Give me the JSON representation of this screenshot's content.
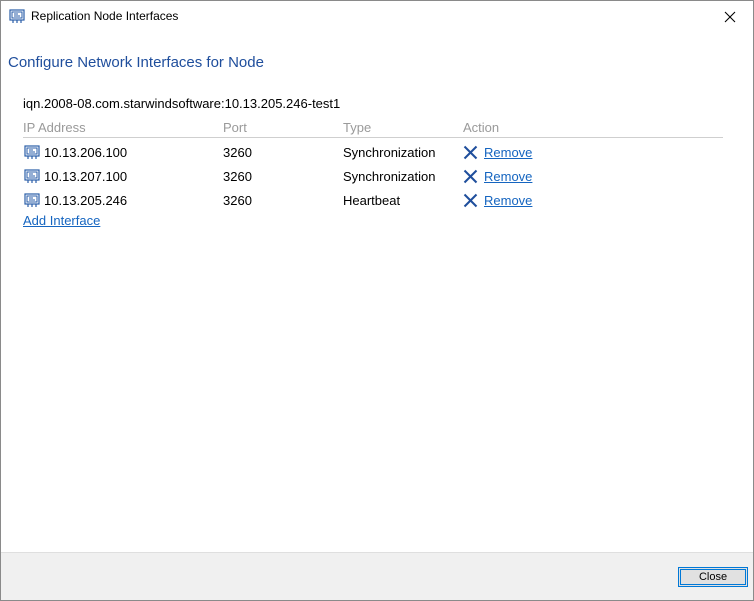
{
  "window": {
    "title": "Replication Node Interfaces",
    "icon": "network-adapter-icon"
  },
  "dialog": {
    "heading": "Configure Network Interfaces for Node",
    "node_name": "iqn.2008-08.com.starwindsoftware:10.13.205.246-test1"
  },
  "table": {
    "columns": [
      "IP Address",
      "Port",
      "Type",
      "Action"
    ],
    "rows": [
      {
        "ip": "10.13.206.100",
        "port": "3260",
        "type": "Synchronization",
        "action": "Remove"
      },
      {
        "ip": "10.13.207.100",
        "port": "3260",
        "type": "Synchronization",
        "action": "Remove"
      },
      {
        "ip": "10.13.205.246",
        "port": "3260",
        "type": "Heartbeat",
        "action": "Remove"
      }
    ]
  },
  "add_interface_label": "Add Interface",
  "footer": {
    "close_label": "Close"
  },
  "colors": {
    "heading": "#1f4e9c",
    "link": "#1565c0",
    "remove_x": "#1f4e9c",
    "column_header": "#9a9a9a",
    "footer_bg": "#f0f0f0",
    "button_border": "#0078d7"
  }
}
